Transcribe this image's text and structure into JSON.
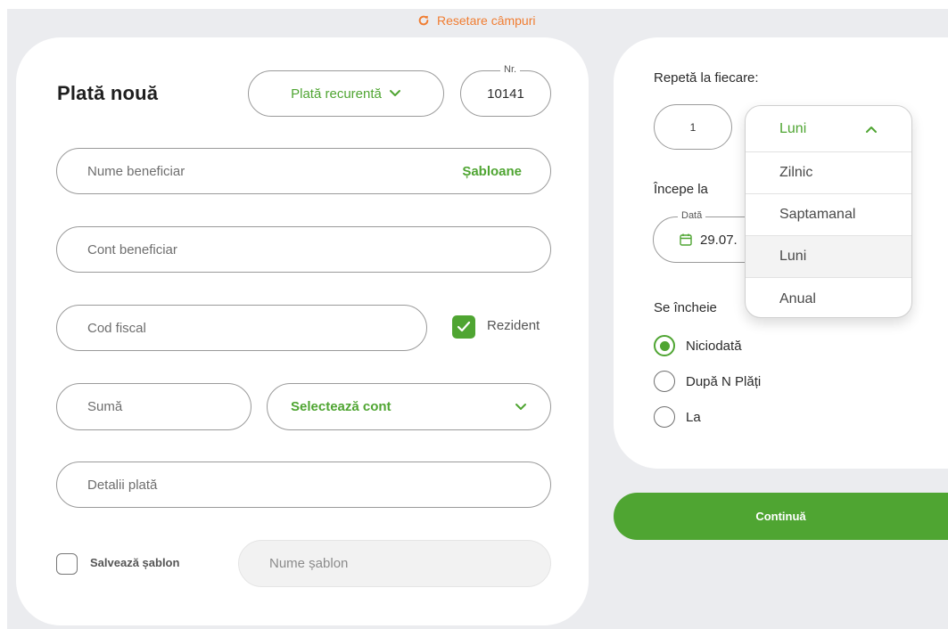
{
  "header": {
    "reset_label": "Resetare câmpuri"
  },
  "form": {
    "title": "Plată nouă",
    "payment_type": "Plată recurentă",
    "nr_label": "Nr.",
    "nr_value": "10141",
    "beneficiary_name_placeholder": "Nume beneficiar",
    "templates_link": "Șabloane",
    "beneficiary_account_placeholder": "Cont beneficiar",
    "fiscal_code_placeholder": "Cod fiscal",
    "resident_label": "Rezident",
    "resident_checked": true,
    "amount_placeholder": "Sumă",
    "select_account": "Selectează cont",
    "details_placeholder": "Detalii plată",
    "save_template_label": "Salvează șablon",
    "template_name_placeholder": "Nume șablon"
  },
  "recurrence": {
    "repeat_label": "Repetă la fiecare:",
    "count": "1",
    "unit_selected": "Luni",
    "unit_options": [
      "Zilnic",
      "Saptamanal",
      "Luni",
      "Anual"
    ],
    "start_label": "Începe la",
    "date_label": "Dată",
    "date_value": "29.07.",
    "end_label": "Se încheie",
    "end_options": [
      "Niciodată",
      "După N Plăți",
      "La"
    ],
    "end_selected": "Niciodată"
  },
  "actions": {
    "continue_label": "Continuă"
  },
  "colors": {
    "accent": "#4fa532",
    "reset": "#f07d32",
    "background": "#ebecef"
  }
}
